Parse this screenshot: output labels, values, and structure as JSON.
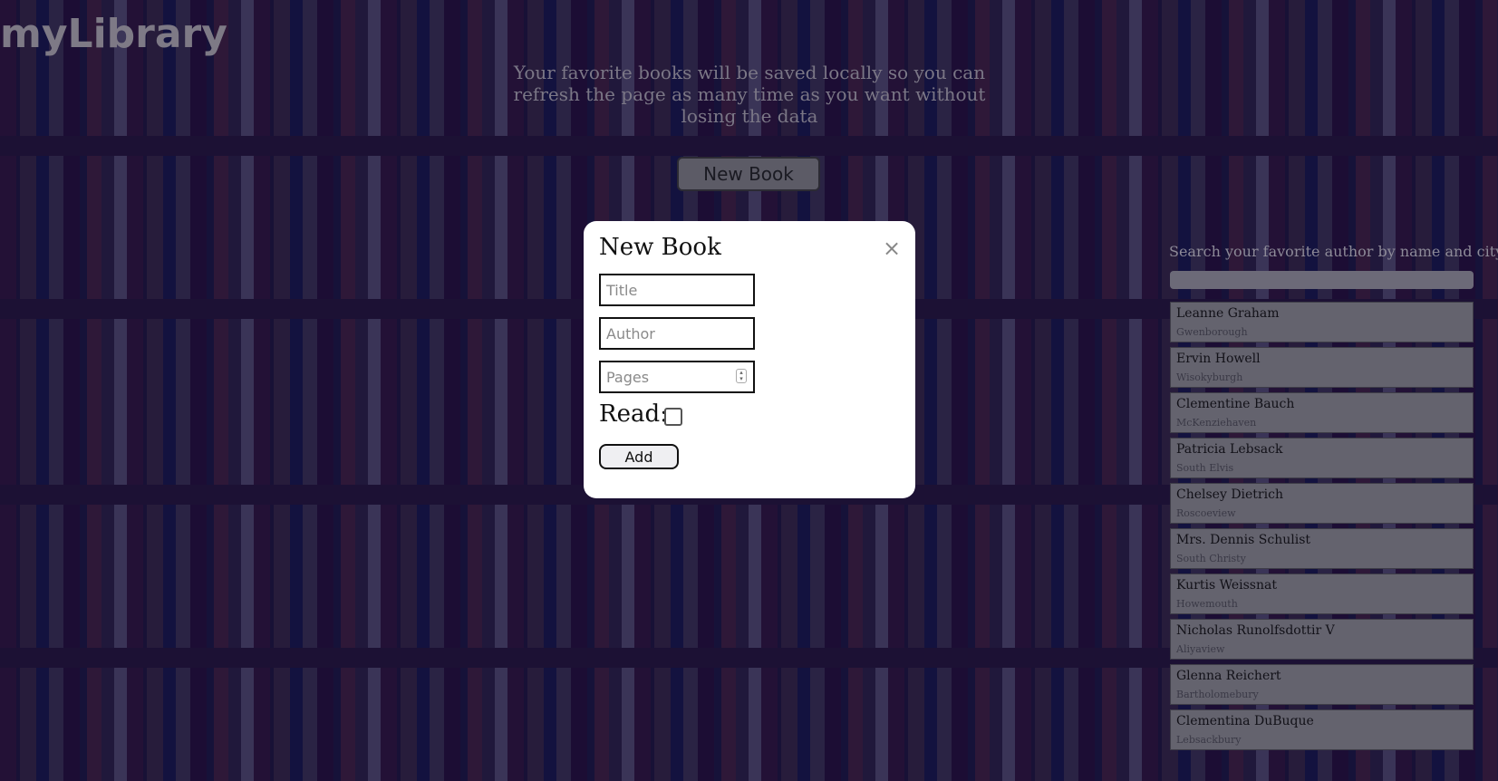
{
  "header": {
    "app_title": "myLibrary",
    "subtitle": "Your favorite books will be saved locally so you can refresh the page as many time as you want without losing the data",
    "new_book_label": "New Book"
  },
  "modal": {
    "title": "New Book",
    "close_symbol": "×",
    "title_placeholder": "Title",
    "author_placeholder": "Author",
    "pages_placeholder": "Pages",
    "read_label": "Read:",
    "read_checked": false,
    "add_label": "Add"
  },
  "search": {
    "label": "Search your favorite author by name and city",
    "value": ""
  },
  "authors": [
    {
      "name": "Leanne Graham",
      "city": "Gwenborough"
    },
    {
      "name": "Ervin Howell",
      "city": "Wisokyburgh"
    },
    {
      "name": "Clementine Bauch",
      "city": "McKenziehaven"
    },
    {
      "name": "Patricia Lebsack",
      "city": "South Elvis"
    },
    {
      "name": "Chelsey Dietrich",
      "city": "Roscoeview"
    },
    {
      "name": "Mrs. Dennis Schulist",
      "city": "South Christy"
    },
    {
      "name": "Kurtis Weissnat",
      "city": "Howemouth"
    },
    {
      "name": "Nicholas Runolfsdottir V",
      "city": "Aliyaview"
    },
    {
      "name": "Glenna Reichert",
      "city": "Bartholomebury"
    },
    {
      "name": "Clementina DuBuque",
      "city": "Lebsackbury"
    }
  ],
  "colors": {
    "overlay": "#0f0a3c",
    "modal_background": "#ffffff",
    "card_background": "#64636e"
  }
}
